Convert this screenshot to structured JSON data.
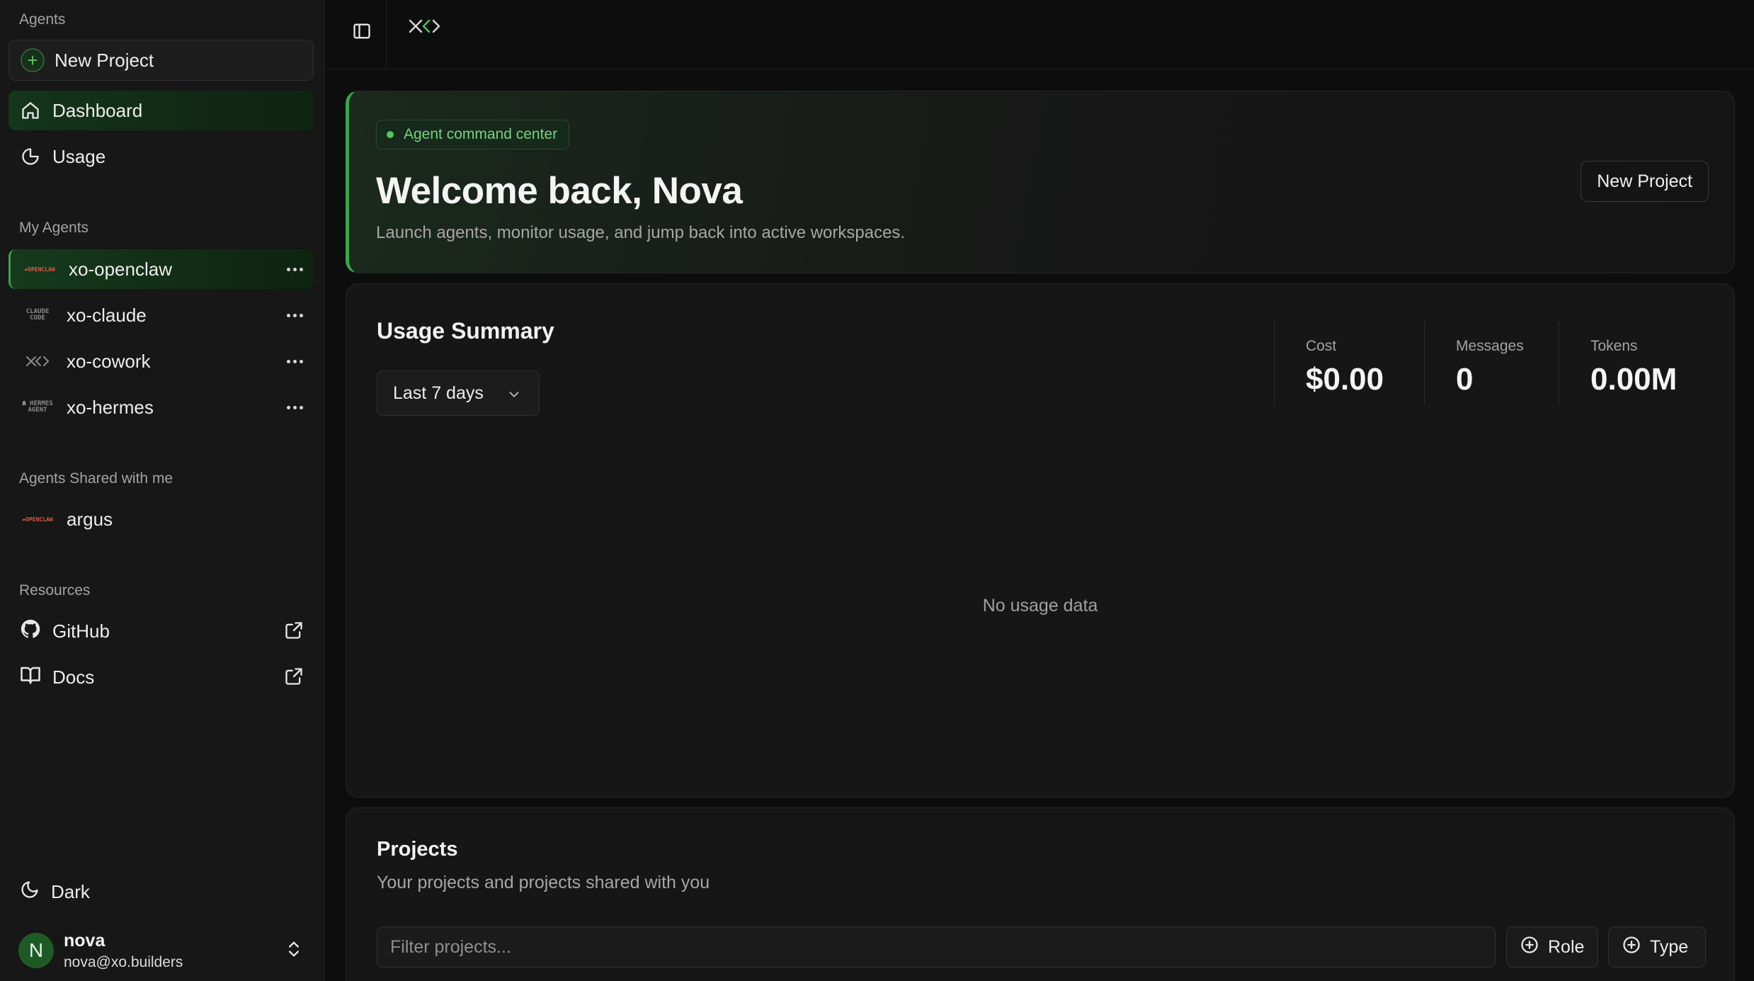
{
  "sidebar": {
    "agents_label": "Agents",
    "new_project_label": "New Project",
    "nav": [
      {
        "label": "Dashboard",
        "icon": "home-icon",
        "active": true
      },
      {
        "label": "Usage",
        "icon": "pie-chart-icon",
        "active": false
      }
    ],
    "my_agents_label": "My Agents",
    "my_agents": [
      {
        "label": "xo-openclaw",
        "logo": "openclaw-logo-icon",
        "active": true
      },
      {
        "label": "xo-claude",
        "logo": "claude-code-logo-icon",
        "active": false
      },
      {
        "label": "xo-cowork",
        "logo": "xo-logo-icon",
        "active": false
      },
      {
        "label": "xo-hermes",
        "logo": "hermes-agent-logo-icon",
        "active": false
      }
    ],
    "shared_label": "Agents Shared with me",
    "shared_agents": [
      {
        "label": "argus",
        "logo": "openclaw-logo-icon"
      }
    ],
    "resources_label": "Resources",
    "resources": [
      {
        "label": "GitHub",
        "icon": "github-icon"
      },
      {
        "label": "Docs",
        "icon": "book-icon"
      }
    ],
    "theme_label": "Dark",
    "user": {
      "initial": "N",
      "name": "nova",
      "email": "nova@xo.builders"
    }
  },
  "hero": {
    "badge": "Agent command center",
    "title": "Welcome back, Nova",
    "subtitle": "Launch agents, monitor usage, and jump back into active workspaces.",
    "button": "New Project"
  },
  "usage": {
    "title": "Usage Summary",
    "range": "Last 7 days",
    "stats": [
      {
        "label": "Cost",
        "value": "$0.00"
      },
      {
        "label": "Messages",
        "value": "0"
      },
      {
        "label": "Tokens",
        "value": "0.00M"
      }
    ],
    "empty": "No usage data"
  },
  "projects": {
    "title": "Projects",
    "subtitle": "Your projects and projects shared with you",
    "filter_placeholder": "Filter projects...",
    "filter_value": "",
    "role_label": "Role",
    "type_label": "Type"
  },
  "colors": {
    "accent": "#3aa648",
    "background": "#0d0d0d",
    "sidebar": "#171717",
    "card": "#161616"
  }
}
